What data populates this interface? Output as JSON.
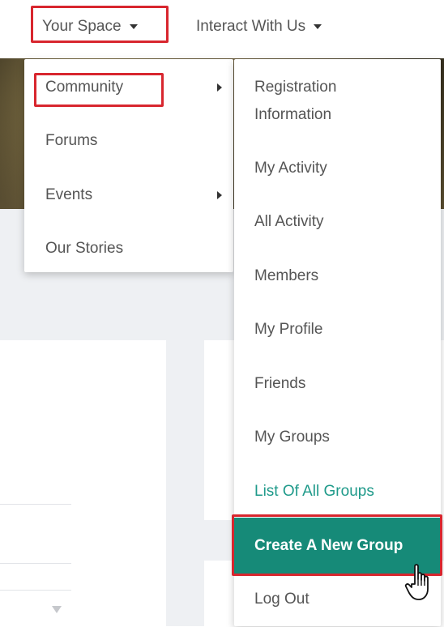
{
  "nav": {
    "your_space": "Your Space",
    "interact": "Interact With Us"
  },
  "primary_menu": {
    "items": [
      {
        "label": "Community",
        "has_submenu": true
      },
      {
        "label": "Forums",
        "has_submenu": false
      },
      {
        "label": "Events",
        "has_submenu": true
      },
      {
        "label": "Our Stories",
        "has_submenu": false
      }
    ]
  },
  "community_submenu": {
    "items": [
      {
        "label": "Registration Information"
      },
      {
        "label": "My Activity"
      },
      {
        "label": "All Activity"
      },
      {
        "label": "Members"
      },
      {
        "label": "My Profile"
      },
      {
        "label": "Friends"
      },
      {
        "label": "My Groups"
      },
      {
        "label": "List Of All Groups"
      },
      {
        "label": "Create A New Group"
      },
      {
        "label": "Log Out"
      }
    ]
  },
  "colors": {
    "accent": "#168a78",
    "link": "#1f9a8a",
    "highlight_box": "#d8262e"
  },
  "icons": {
    "cursor": "hand-pointer-icon"
  }
}
